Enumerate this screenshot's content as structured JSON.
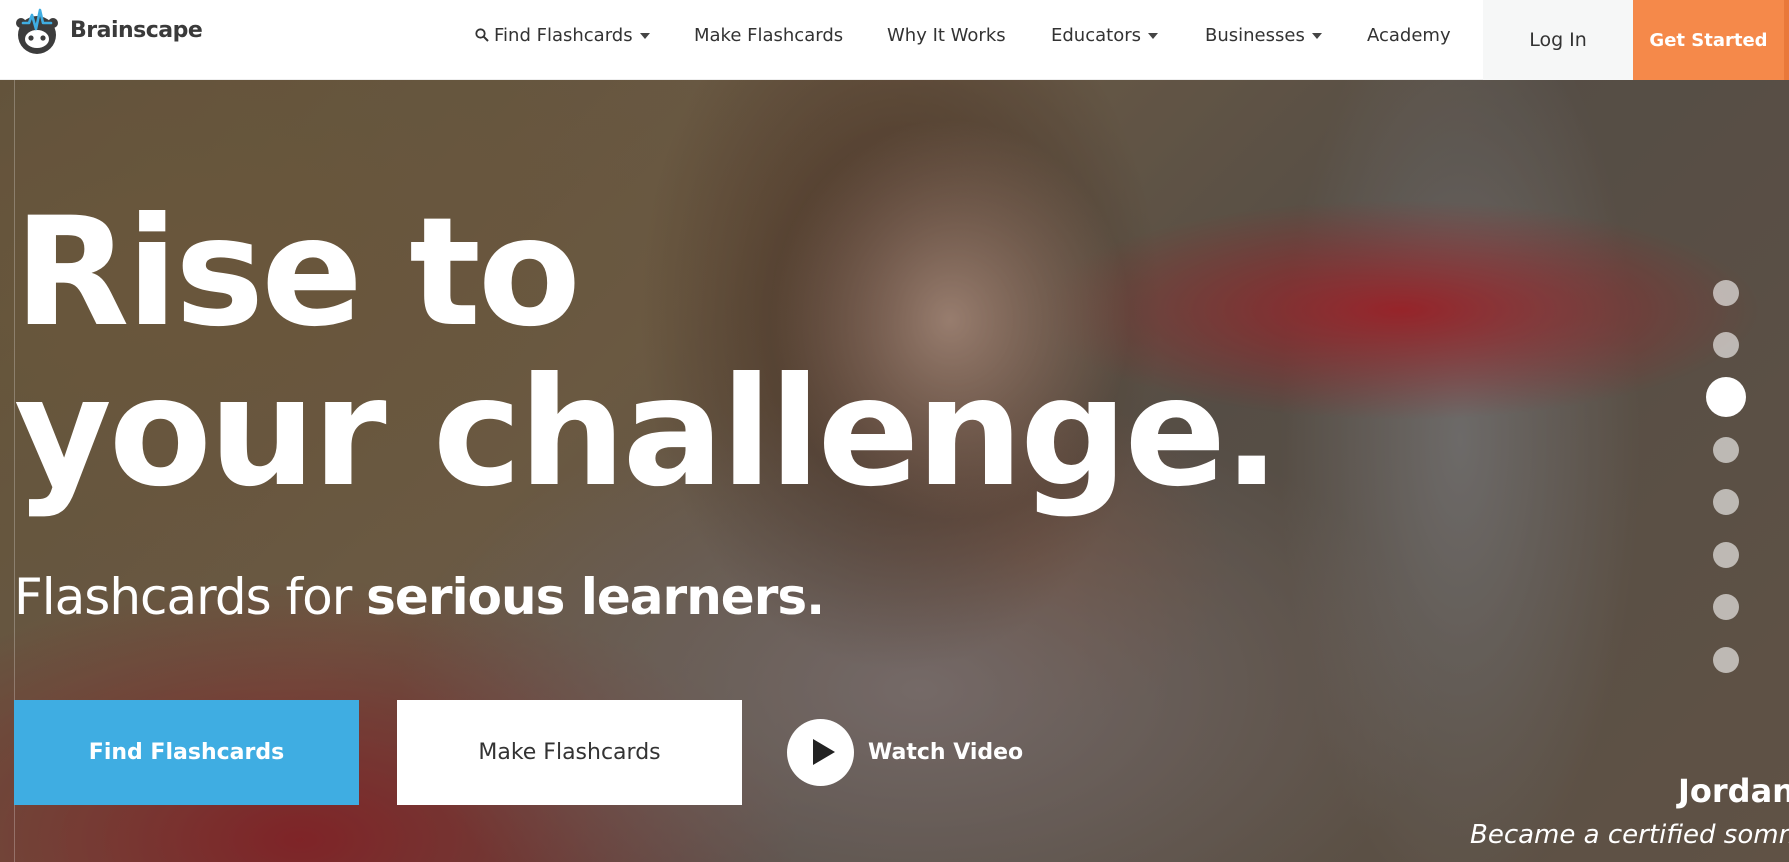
{
  "brand": {
    "name": "Brainscape",
    "accent_color": "#f5894a",
    "logo_icon": "brain-mascot-icon"
  },
  "nav": {
    "items": [
      {
        "label": "Find Flashcards",
        "icon": "search-icon",
        "has_dropdown": true
      },
      {
        "label": "Make Flashcards",
        "has_dropdown": false
      },
      {
        "label": "Why It Works",
        "has_dropdown": false
      },
      {
        "label": "Educators",
        "has_dropdown": true
      },
      {
        "label": "Businesses",
        "has_dropdown": true
      },
      {
        "label": "Academy",
        "has_dropdown": false
      }
    ],
    "login_label": "Log In",
    "get_started_label": "Get Started"
  },
  "hero": {
    "headline_line1": "Rise to",
    "headline_line2": "your challenge.",
    "subhead_light": "Flashcards for ",
    "subhead_bold": "serious learners.",
    "find_button_label": "Find Flashcards",
    "find_button_color": "#3fade2",
    "make_button_label": "Make Flashcards",
    "watch_label": "Watch Video",
    "carousel": {
      "count": 8,
      "active_index": 2
    },
    "testimonial": {
      "name": "Jordan",
      "caption": "Became a certified somme"
    }
  }
}
